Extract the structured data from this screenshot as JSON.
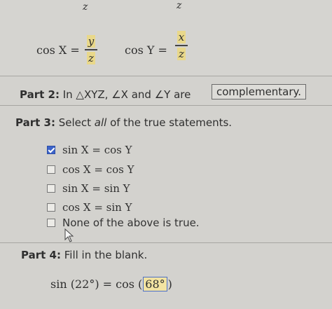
{
  "top": {
    "fragments": [
      "z",
      "z"
    ],
    "eq1": {
      "lhs": "cos X =",
      "num": "y",
      "den": "z"
    },
    "eq2": {
      "lhs": "cos Y =",
      "num": "x",
      "den": "z"
    }
  },
  "part2": {
    "label": "Part 2:",
    "text_pre": "In △XYZ, ∠X and ∠Y are",
    "answer": "complementary."
  },
  "part3": {
    "label": "Part 3:",
    "instruction_pre": "Select ",
    "instruction_emph": "all",
    "instruction_post": " of the true statements.",
    "options": [
      {
        "text": "sin X = cos Y",
        "checked": true
      },
      {
        "text": "cos X = cos Y",
        "checked": false
      },
      {
        "text": "sin X = sin Y",
        "checked": false
      },
      {
        "text": "cos X = sin Y",
        "checked": false
      },
      {
        "text": "None of the above is true.",
        "checked": false
      }
    ]
  },
  "part4": {
    "label": "Part 4:",
    "instruction": "Fill in the blank.",
    "eq_pre": "sin (22°) = cos (",
    "blank_value": "68°",
    "eq_post": ")"
  },
  "colors": {
    "checkbox_checked": "#3d64c9",
    "highlight": "#e9d88a"
  }
}
